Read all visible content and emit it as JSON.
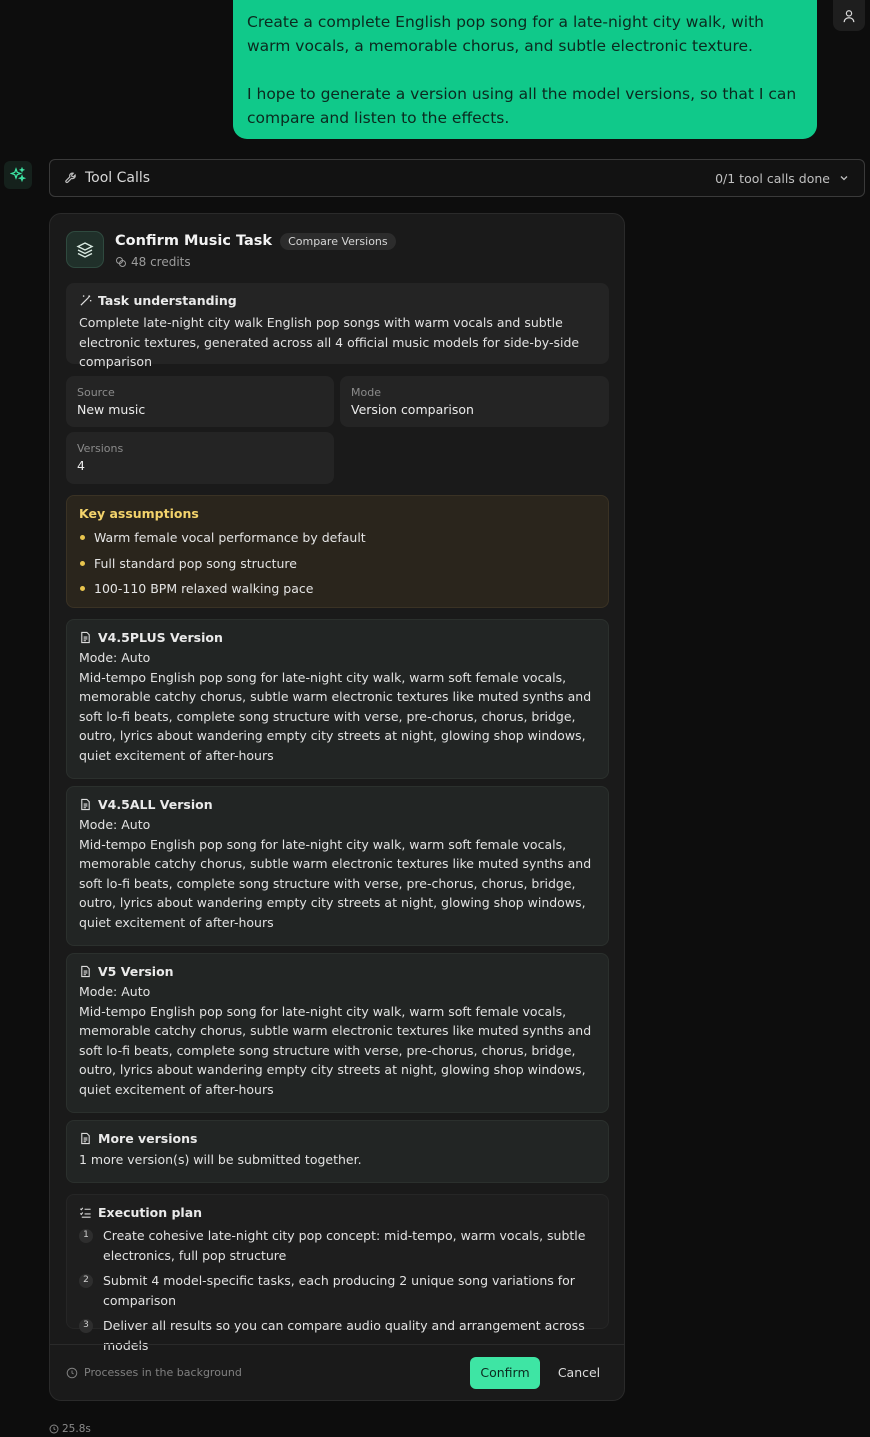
{
  "user_message": {
    "paragraph1": "Create a complete English pop song for a late-night city walk, with warm vocals, a memorable chorus, and subtle electronic texture.",
    "paragraph2": "I hope to generate a version using all the model versions, so that I can compare and listen to the effects."
  },
  "tool_calls": {
    "title": "Tool Calls",
    "status": "0/1 tool calls done"
  },
  "card": {
    "title": "Confirm Music Task",
    "badge": "Compare Versions",
    "credits": "48 credits",
    "task_understanding": {
      "title": "Task understanding",
      "text": "Complete late-night city walk English pop songs with warm vocals and subtle electronic textures, generated across all 4 official music models for side-by-side comparison"
    },
    "fields": [
      {
        "label": "Source",
        "value": "New music"
      },
      {
        "label": "Mode",
        "value": "Version comparison"
      },
      {
        "label": "Versions",
        "value": "4"
      }
    ],
    "assumptions": {
      "title": "Key assumptions",
      "items": [
        "Warm female vocal performance by default",
        "Full standard pop song structure",
        "100-110 BPM relaxed walking pace"
      ]
    },
    "versions": [
      {
        "title": "V4.5PLUS Version",
        "mode": "Mode: Auto",
        "prompt": "Mid-tempo English pop song for late-night city walk, warm soft female vocals, memorable catchy chorus, subtle warm electronic textures like muted synths and soft lo-fi beats, complete song structure with verse, pre-chorus, chorus, bridge, outro, lyrics about wandering empty city streets at night, glowing shop windows, quiet excitement of after-hours"
      },
      {
        "title": "V4.5ALL Version",
        "mode": "Mode: Auto",
        "prompt": "Mid-tempo English pop song for late-night city walk, warm soft female vocals, memorable catchy chorus, subtle warm electronic textures like muted synths and soft lo-fi beats, complete song structure with verse, pre-chorus, chorus, bridge, outro, lyrics about wandering empty city streets at night, glowing shop windows, quiet excitement of after-hours"
      },
      {
        "title": "V5 Version",
        "mode": "Mode: Auto",
        "prompt": "Mid-tempo English pop song for late-night city walk, warm soft female vocals, memorable catchy chorus, subtle warm electronic textures like muted synths and soft lo-fi beats, complete song structure with verse, pre-chorus, chorus, bridge, outro, lyrics about wandering empty city streets at night, glowing shop windows, quiet excitement of after-hours"
      }
    ],
    "more_versions": {
      "title": "More versions",
      "text": "1 more version(s) will be submitted together."
    },
    "plan": {
      "title": "Execution plan",
      "steps": [
        {
          "n": "1",
          "text": "Create cohesive late-night city pop concept: mid-tempo, warm vocals, subtle electronics, full pop structure"
        },
        {
          "n": "2",
          "text": "Submit 4 model-specific tasks, each producing 2 unique song variations for comparison"
        },
        {
          "n": "3",
          "text": "Deliver all results so you can compare audio quality and arrangement across models"
        }
      ]
    },
    "footer": {
      "note": "Processes in the background",
      "confirm": "Confirm",
      "cancel": "Cancel"
    }
  },
  "elapsed": "25.8s",
  "colors": {
    "accent": "#10c98a",
    "confirm": "#3ee5a4",
    "assumption": "#f3d36b",
    "background": "#0d0d0d"
  }
}
